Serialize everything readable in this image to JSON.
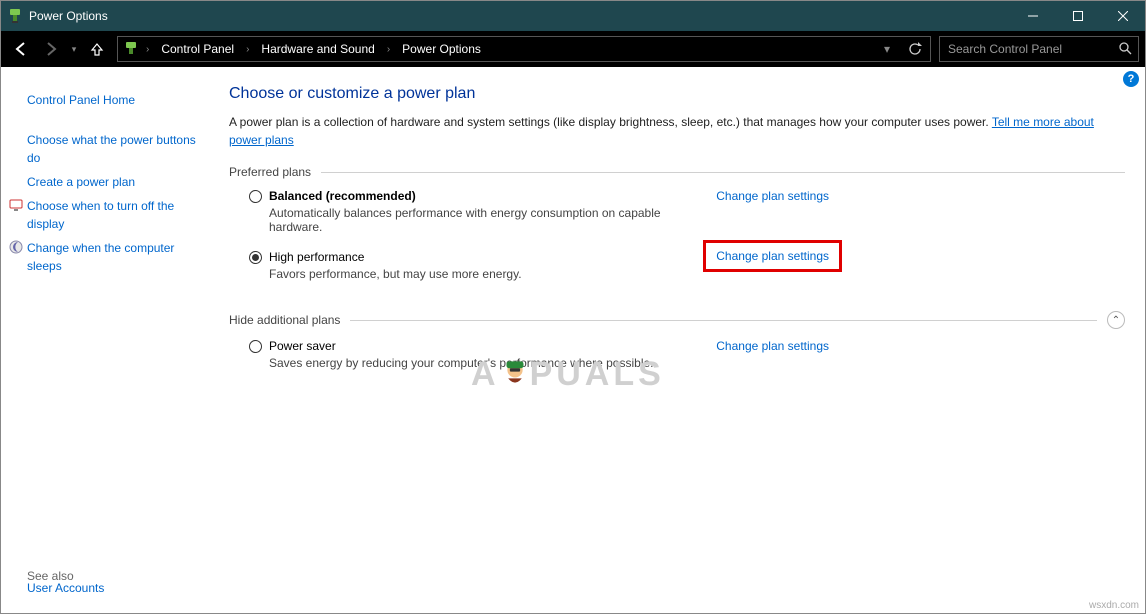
{
  "window": {
    "title": "Power Options"
  },
  "breadcrumb": {
    "a": "Control Panel",
    "b": "Hardware and Sound",
    "c": "Power Options"
  },
  "search": {
    "placeholder": "Search Control Panel"
  },
  "sidebar": {
    "home": "Control Panel Home",
    "links": [
      "Choose what the power buttons do",
      "Create a power plan",
      "Choose when to turn off the display",
      "Change when the computer sleeps"
    ],
    "seealso": "See also",
    "useraccounts": "User Accounts"
  },
  "main": {
    "heading": "Choose or customize a power plan",
    "desc1": "A power plan is a collection of hardware and system settings (like display brightness, sleep, etc.) that manages how your computer uses power. ",
    "desclink": "Tell me more about power plans",
    "section1": "Preferred plans",
    "section2": "Hide additional plans",
    "changelink": "Change plan settings",
    "plans": {
      "balanced": {
        "name": "Balanced (recommended)",
        "desc": "Automatically balances performance with energy consumption on capable hardware."
      },
      "high": {
        "name": "High performance",
        "desc": "Favors performance, but may use more energy."
      },
      "saver": {
        "name": "Power saver",
        "desc": "Saves energy by reducing your computer's performance where possible."
      }
    }
  },
  "watermark": {
    "a": "A",
    "b": "PUALS"
  },
  "source": "wsxdn.com"
}
